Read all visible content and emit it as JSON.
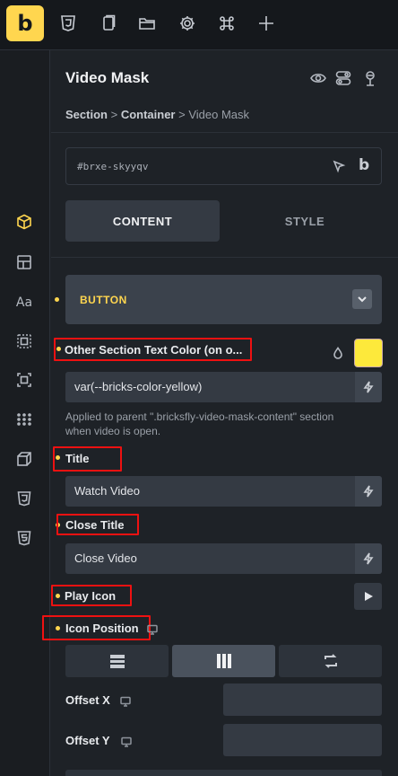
{
  "app": {
    "logo_letter": "b",
    "brand_color": "#ffd64f"
  },
  "topbar": {
    "icons": [
      "css3-icon",
      "pages-icon",
      "folder-icon",
      "settings-icon",
      "command-icon",
      "plus-icon"
    ]
  },
  "sidebar": {
    "items": [
      {
        "icon": "cube-icon",
        "active": true
      },
      {
        "icon": "layout-icon"
      },
      {
        "icon": "typography-icon",
        "text": "Aa"
      },
      {
        "icon": "spacing-icon"
      },
      {
        "icon": "frame-icon"
      },
      {
        "icon": "grid-dots-icon"
      },
      {
        "icon": "3d-box-icon"
      },
      {
        "icon": "css3-icon"
      },
      {
        "icon": "html5-icon"
      }
    ]
  },
  "panel": {
    "title": "Video Mask",
    "breadcrumb": {
      "section": "Section",
      "sep1": ">",
      "container": "Container",
      "sep2": ">",
      "current": "Video Mask"
    },
    "element_id": "#brxe-skyyqv",
    "id_brand": "b",
    "tabs": {
      "content": "CONTENT",
      "style": "STYLE"
    }
  },
  "group": {
    "label": "BUTTON"
  },
  "controls": {
    "other_section_color": {
      "label": "Other Section Text Color (on o...",
      "value": "var(--bricks-color-yellow)",
      "swatch": "#fde93b",
      "help": "Applied to parent \".bricksfly-video-mask-content\" section when video is open."
    },
    "title": {
      "label": "Title",
      "value": "Watch Video"
    },
    "close_title": {
      "label": "Close Title",
      "value": "Close Video"
    },
    "play_icon": {
      "label": "Play Icon"
    },
    "icon_position": {
      "label": "Icon Position",
      "options": [
        "stacked",
        "columns",
        "swap"
      ],
      "selected": "columns"
    },
    "offset_x": {
      "label": "Offset X",
      "value": ""
    },
    "offset_y": {
      "label": "Offset Y",
      "value": ""
    }
  }
}
